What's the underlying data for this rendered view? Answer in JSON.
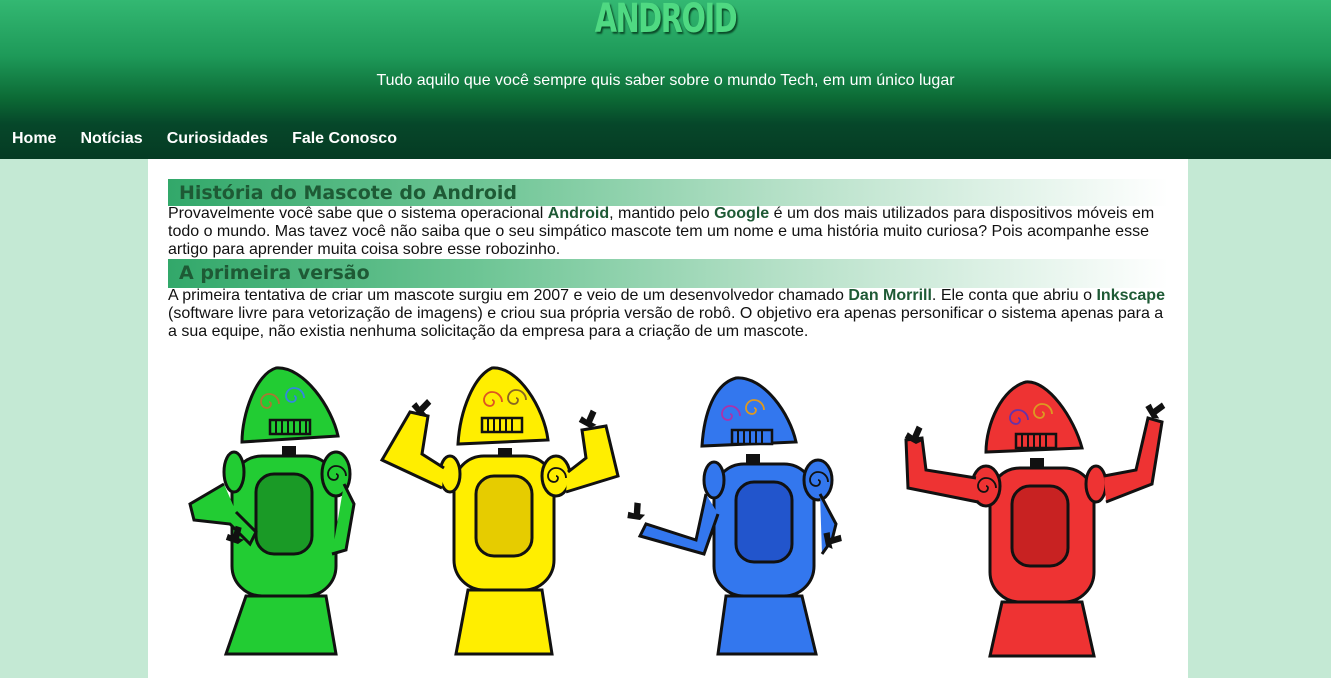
{
  "header": {
    "logo": "ANDROID",
    "tagline": "Tudo aquilo que você sempre quis saber sobre o mundo Tech, em um único lugar"
  },
  "nav": {
    "items": [
      "Home",
      "Notícias",
      "Curiosidades",
      "Fale Conosco"
    ]
  },
  "section1": {
    "title": "História do Mascote do Android",
    "p1": "Provavelmente você sabe que o sistema operacional ",
    "android": "Android",
    "p2": ", mantido pelo ",
    "google": "Google",
    "p3": " é um dos mais utilizados para dispositivos móveis em todo o mundo. Mas tavez você não saiba que o seu simpático mascote tem um nome e uma história muito curiosa? Pois acompanhe esse artigo para aprender muita coisa sobre esse robozinho."
  },
  "section2": {
    "title": "A primeira versão",
    "p1": "A primeira tentativa de criar um mascote surgiu em 2007 e veio de um desenvolvedor chamado ",
    "dan": "Dan Morrill",
    "p2": ". Ele conta que abriu o ",
    "inkscape": "Inkscape",
    "p3": " (software livre para vetorização de imagens) e criou sua própria versão de robô. O objetivo era apenas personificar o sistema apenas para a a sua equipe, não existia nenhuma solicitação da empresa para a criação de um mascote."
  },
  "robots": [
    {
      "name": "green",
      "body": "#22cc33",
      "dark": "#129a22"
    },
    {
      "name": "yellow",
      "body": "#ffee00",
      "dark": "#e0c800"
    },
    {
      "name": "blue",
      "body": "#3377ee",
      "dark": "#2255cc"
    },
    {
      "name": "red",
      "body": "#ee3333",
      "dark": "#c82222"
    }
  ],
  "colors": {
    "page_bg": "#c4e9d4",
    "header_top": "#33b872",
    "header_bottom": "#053b23",
    "accent_text": "#1e5a35",
    "logo": "#4fd982"
  }
}
